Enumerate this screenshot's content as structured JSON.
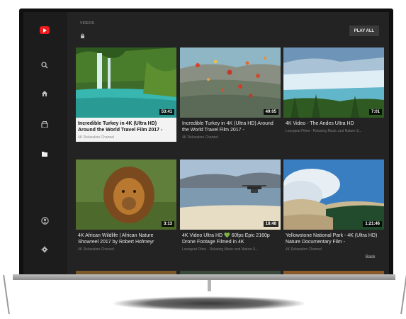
{
  "header": {
    "section_label": "VIDEOS",
    "lock_icon": "lock-icon",
    "play_all_label": "PLAY ALL"
  },
  "sidebar": {
    "items": [
      {
        "icon": "youtube-logo-icon"
      },
      {
        "icon": "search-icon"
      },
      {
        "icon": "home-icon"
      },
      {
        "icon": "subscriptions-icon"
      },
      {
        "icon": "library-folder-icon"
      },
      {
        "icon": "account-icon"
      },
      {
        "icon": "settings-icon"
      }
    ]
  },
  "videos": [
    {
      "title": "Incredible Turkey in 4K (Ultra HD) Around the World Travel Film 2017 -",
      "channel": "4K Relaxation Channel",
      "duration": "53:41"
    },
    {
      "title": "Incredible Turkey in 4K (Ultra HD) Around the World Travel Film 2017 -",
      "channel": "4K Relaxation Channel",
      "duration": "49:05"
    },
    {
      "title": "4K Video - The Andes Ultra HD",
      "channel": "Loungeat Films - Relaxing Music and Nature S...",
      "duration": "7:01"
    },
    {
      "title": "4K African Wildlife | African Nature Showreel 2017 by Robert Hofmeyr",
      "channel": "4K Relaxation Channel",
      "duration": "3:13"
    },
    {
      "title": "4K Video Ultra HD 💚 60fps Epic 2160p Drone Footage Filmed in 4K",
      "channel": "Loungeat Films - Relaxing Music and Nature S...",
      "duration": "18:48"
    },
    {
      "title": "Yellowstone National Park - 4K (Ultra HD) Nature Documentary Film -",
      "channel": "4K Relaxation Channel",
      "duration": "1:21:46"
    }
  ],
  "footer": {
    "back_label": "Back"
  },
  "colors": {
    "accent": "#ee1c1c",
    "background": "#232323",
    "sidebar": "#1c1c1c"
  }
}
